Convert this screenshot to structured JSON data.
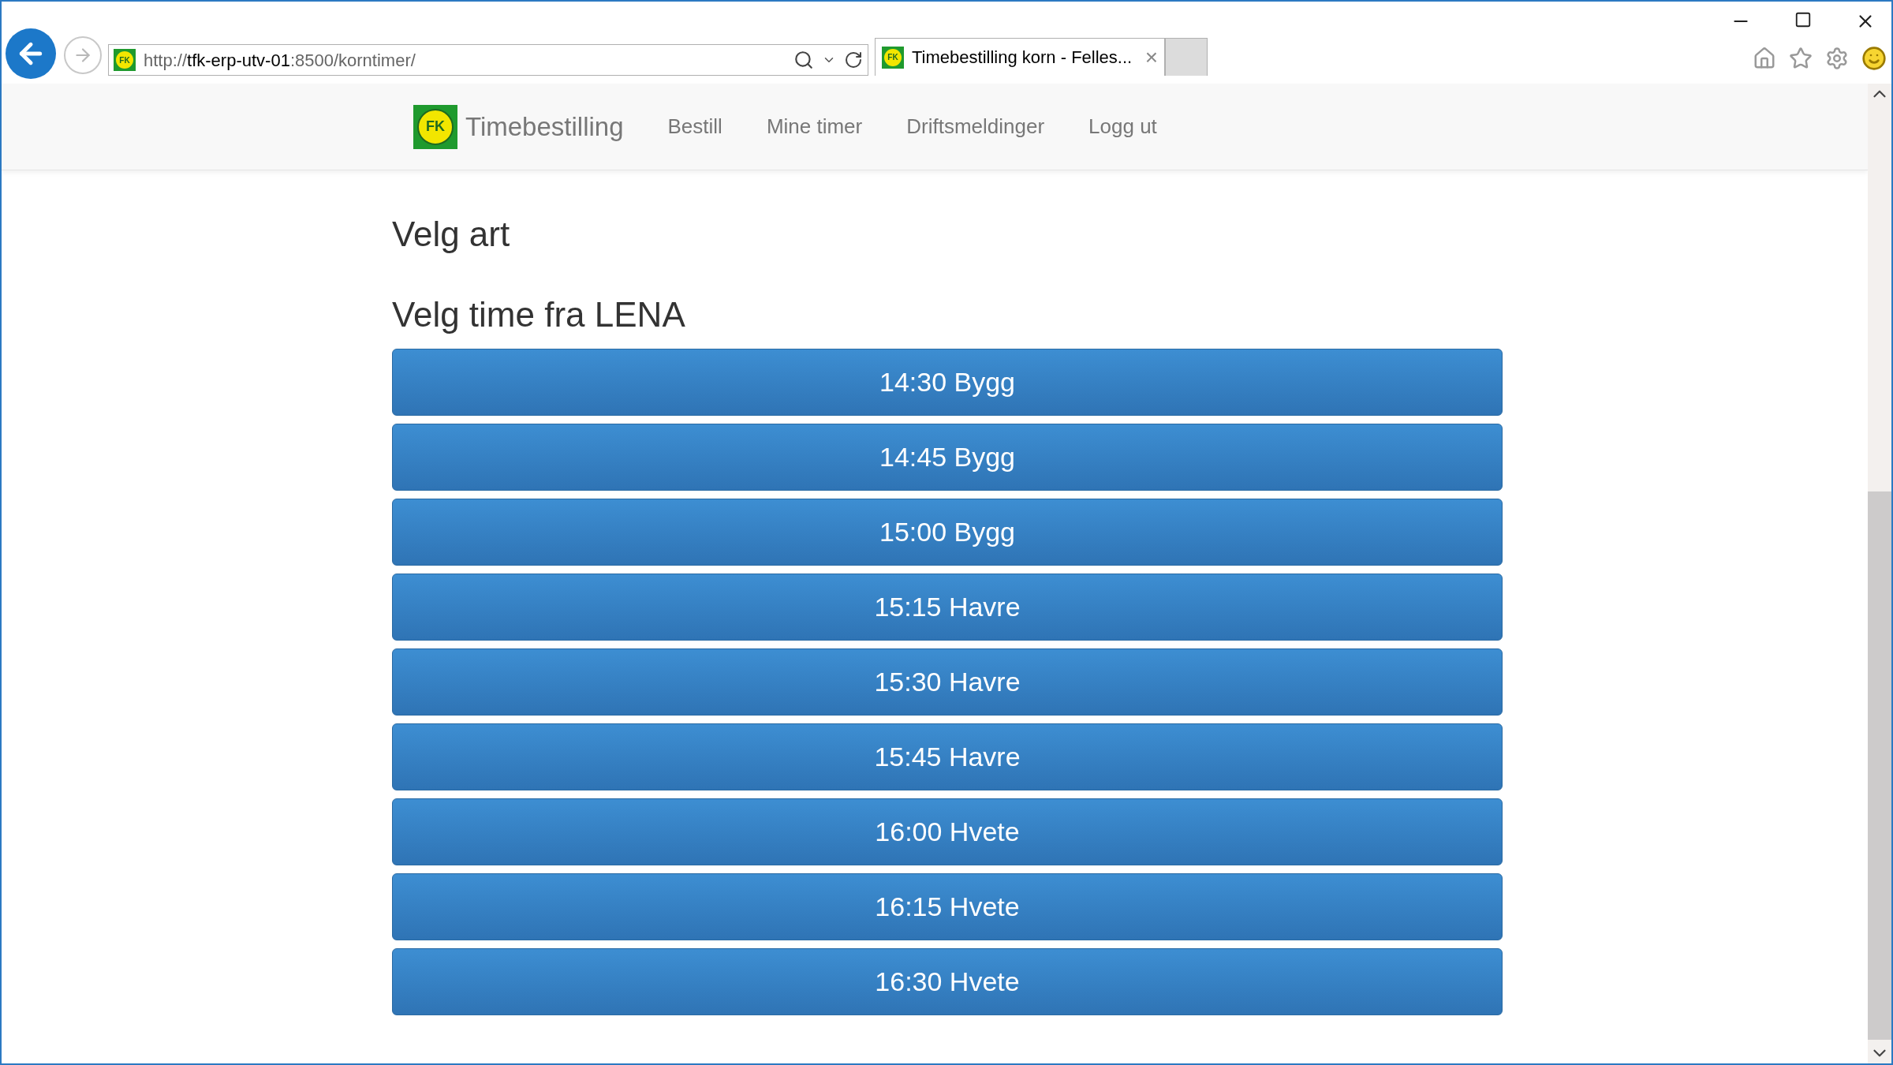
{
  "browser": {
    "url": "http://**tfk-erp-utv-01**:8500/korntimer/",
    "tab_title": "Timebestilling korn - Felles...",
    "tab_close": "×",
    "address_favicon_text": "FK",
    "tab_favicon_text": "FK"
  },
  "navbar": {
    "brand": "Timebestilling",
    "logo_text": "FK",
    "links": [
      {
        "label": "Bestill"
      },
      {
        "label": "Mine timer"
      },
      {
        "label": "Driftsmeldinger"
      },
      {
        "label": "Logg ut"
      }
    ]
  },
  "headings": [
    "Velg art",
    "Velg time fra LENA"
  ],
  "slots": [
    {
      "label": "14:30 Bygg"
    },
    {
      "label": "14:45 Bygg"
    },
    {
      "label": "15:00 Bygg"
    },
    {
      "label": "15:15 Havre"
    },
    {
      "label": "15:30 Havre"
    },
    {
      "label": "15:45 Havre"
    },
    {
      "label": "16:00 Hvete"
    },
    {
      "label": "16:15 Hvete"
    },
    {
      "label": "16:30 Hvete"
    }
  ]
}
